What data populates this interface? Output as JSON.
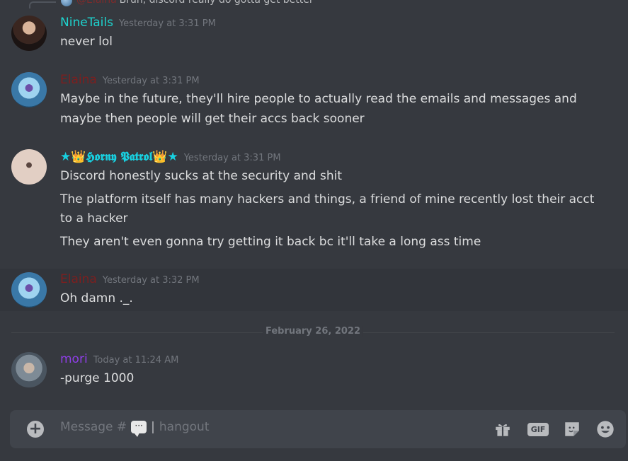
{
  "reply_preview": {
    "mention": "@Elaina",
    "text": "Bruh, discord really do gotta get better"
  },
  "messages": [
    {
      "username": "NineTails",
      "username_color": "#1ed3ce",
      "timestamp": "Yesterday at 3:31 PM",
      "lines": [
        "never lol"
      ]
    },
    {
      "username": "Elaina",
      "username_color": "#7d1f1f",
      "timestamp": "Yesterday at 3:31 PM",
      "lines": [
        "Maybe in the future, they'll hire people to actually read the emails and messages and",
        "maybe then people will get their accs back sooner"
      ]
    },
    {
      "username": "★👑𝕳𝖔𝖗𝖓𝖞 𝕻𝖆𝖙𝖗𝖔𝖑👑★",
      "username_color": "#18d0e0",
      "timestamp": "Yesterday at 3:31 PM",
      "lines": [
        "Discord honestly sucks at the security and shit",
        "The platform itself has many hackers and things, a friend of mine recently lost their acct",
        "to a hacker",
        "They aren't even gonna try getting it back bc it'll take a long ass time"
      ]
    },
    {
      "username": "Elaina",
      "username_color": "#7d1f1f",
      "timestamp": "Yesterday at 3:32 PM",
      "lines": [
        "Oh damn ._."
      ]
    },
    {
      "username": "mori",
      "username_color": "#8f3ee8",
      "timestamp": "Today at 11:24 AM",
      "lines": [
        "-purge 1000"
      ]
    }
  ],
  "date_divider": "February 26, 2022",
  "composer": {
    "placeholder_prefix": "Message #",
    "channel_name": "hangout",
    "separator": "|"
  },
  "icons": {
    "add": "plus-circle-icon",
    "gift": "gift-icon",
    "gif": "GIF",
    "sticker": "sticker-icon",
    "emoji": "emoji-icon"
  }
}
